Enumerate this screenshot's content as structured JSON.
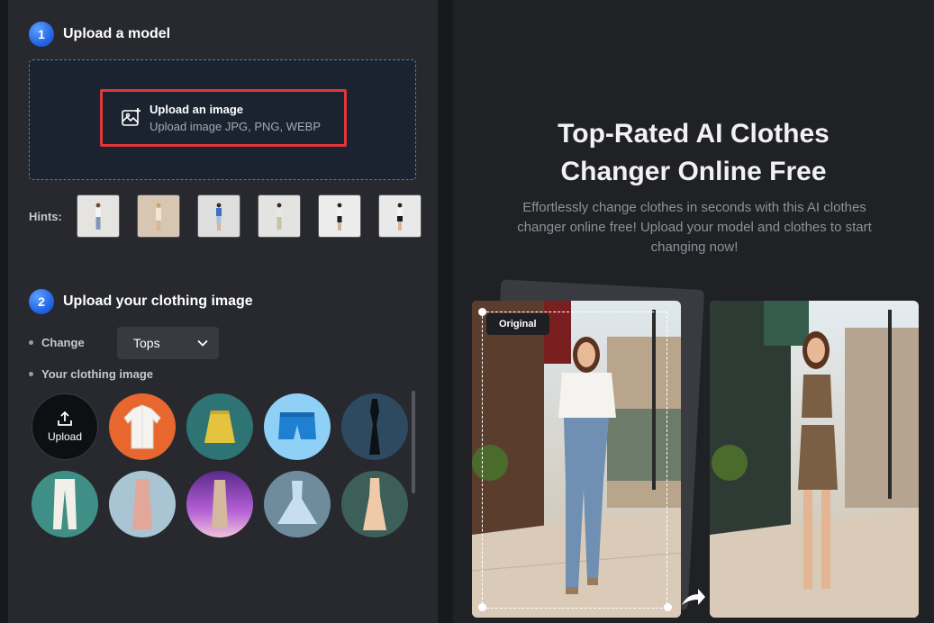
{
  "step1": {
    "number": "1",
    "title": "Upload a model"
  },
  "upload": {
    "title": "Upload an image",
    "subtitle": "Upload image JPG, PNG, WEBP"
  },
  "hints": {
    "label": "Hints:"
  },
  "step2": {
    "number": "2",
    "title": "Upload your clothing image"
  },
  "change": {
    "label": "Change",
    "selected": "Tops"
  },
  "clothing": {
    "label": "Your clothing image",
    "upload_label": "Upload"
  },
  "hero": {
    "title_line1": "Top-Rated AI Clothes",
    "title_line2": "Changer Online Free",
    "description": "Effortlessly change clothes in seconds with this AI clothes changer online free! Upload your model and clothes to start changing now!"
  },
  "preview": {
    "original_badge": "Original"
  },
  "colors": {
    "accent": "#1b5ee0",
    "highlight": "#e2373a"
  }
}
